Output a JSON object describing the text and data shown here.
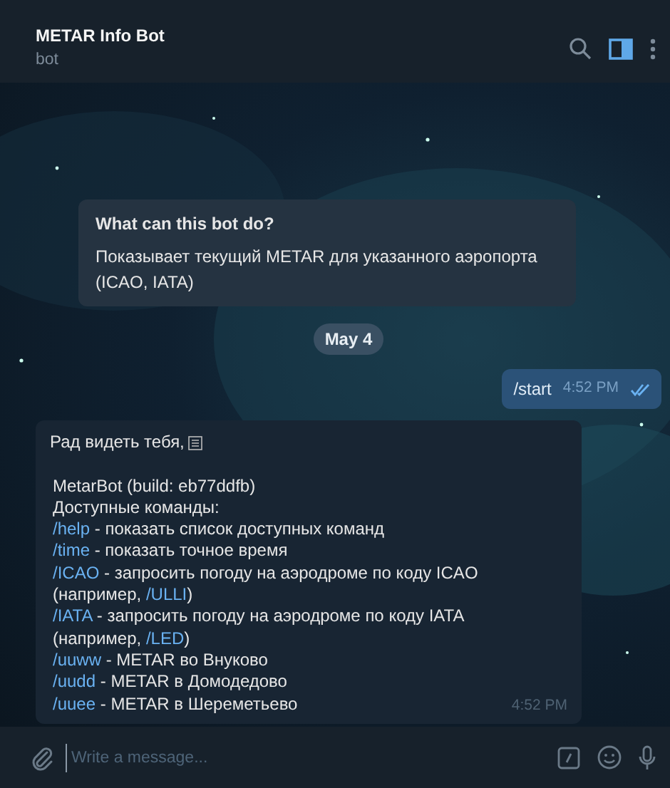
{
  "header": {
    "title": "METAR Info Bot",
    "subtitle": "bot"
  },
  "intro": {
    "title": "What can this bot do?",
    "text": "Показывает текущий METAR для указанного аэропорта (ICAO, IATA)"
  },
  "date_badge": "May 4",
  "outgoing": {
    "text": "/start",
    "time": "4:52 PM",
    "read": true
  },
  "incoming": {
    "time": "4:52 PM",
    "greeting": "Рад видеть тебя,",
    "lines": [
      [
        {
          "kind": "text",
          "text": "MetarBot (build: eb77ddfb)"
        }
      ],
      [
        {
          "kind": "text",
          "text": "Доступные команды:"
        }
      ],
      [
        {
          "kind": "command",
          "text": "/help"
        },
        {
          "kind": "text",
          "text": " - показать список доступных команд"
        }
      ],
      [
        {
          "kind": "command",
          "text": "/time"
        },
        {
          "kind": "text",
          "text": " - показать точное время"
        }
      ],
      [
        {
          "kind": "command",
          "text": "/ICAO"
        },
        {
          "kind": "text",
          "text": " - запросить погоду на аэродроме по коду ICAO"
        }
      ],
      [
        {
          "kind": "text",
          "text": "(например, "
        },
        {
          "kind": "command",
          "text": "/ULLI"
        },
        {
          "kind": "text",
          "text": ")"
        }
      ],
      [
        {
          "kind": "command",
          "text": "/IATA"
        },
        {
          "kind": "text",
          "text": " - запросить погоду на аэродроме по коду IATA"
        }
      ],
      [
        {
          "kind": "text",
          "text": "(например, "
        },
        {
          "kind": "command",
          "text": "/LED"
        },
        {
          "kind": "text",
          "text": ")"
        }
      ],
      [
        {
          "kind": "command",
          "text": "/uuww"
        },
        {
          "kind": "text",
          "text": " - METAR во Внуково"
        }
      ],
      [
        {
          "kind": "command",
          "text": "/uudd"
        },
        {
          "kind": "text",
          "text": " - METAR в Домодедово"
        }
      ],
      [
        {
          "kind": "command",
          "text": "/uuee"
        },
        {
          "kind": "text",
          "text": " - METAR в Шереметьево"
        }
      ]
    ]
  },
  "composer": {
    "placeholder": "Write a message..."
  }
}
